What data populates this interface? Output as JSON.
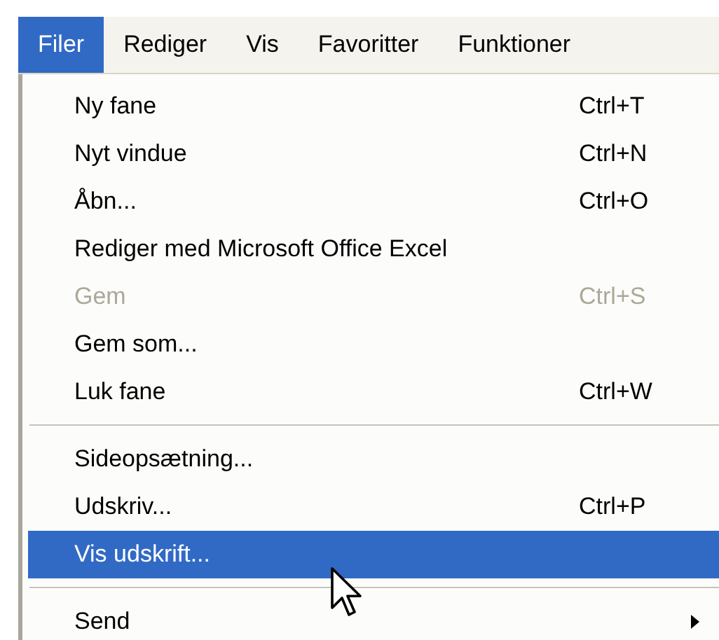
{
  "menubar": [
    {
      "label": "Filer",
      "selected": true
    },
    {
      "label": "Rediger",
      "selected": false
    },
    {
      "label": "Vis",
      "selected": false
    },
    {
      "label": "Favoritter",
      "selected": false
    },
    {
      "label": "Funktioner",
      "selected": false
    }
  ],
  "menu": [
    {
      "kind": "item",
      "label": "Ny fane",
      "shortcut": "Ctrl+T",
      "disabled": false,
      "selected": false
    },
    {
      "kind": "item",
      "label": "Nyt vindue",
      "shortcut": "Ctrl+N",
      "disabled": false,
      "selected": false
    },
    {
      "kind": "item",
      "label": "Åbn...",
      "shortcut": "Ctrl+O",
      "disabled": false,
      "selected": false
    },
    {
      "kind": "item",
      "label": "Rediger med Microsoft Office Excel",
      "disabled": false,
      "selected": false
    },
    {
      "kind": "item",
      "label": "Gem",
      "shortcut": "Ctrl+S",
      "disabled": true,
      "selected": false
    },
    {
      "kind": "item",
      "label": "Gem som...",
      "disabled": false,
      "selected": false
    },
    {
      "kind": "item",
      "label": "Luk fane",
      "shortcut": "Ctrl+W",
      "disabled": false,
      "selected": false
    },
    {
      "kind": "separator"
    },
    {
      "kind": "item",
      "label": "Sideopsætning...",
      "disabled": false,
      "selected": false
    },
    {
      "kind": "item",
      "label": "Udskriv...",
      "shortcut": "Ctrl+P",
      "disabled": false,
      "selected": false
    },
    {
      "kind": "item",
      "label": "Vis udskrift...",
      "disabled": false,
      "selected": true
    },
    {
      "kind": "separator"
    },
    {
      "kind": "item",
      "label": "Send",
      "disabled": false,
      "selected": false,
      "submenu": true
    }
  ]
}
